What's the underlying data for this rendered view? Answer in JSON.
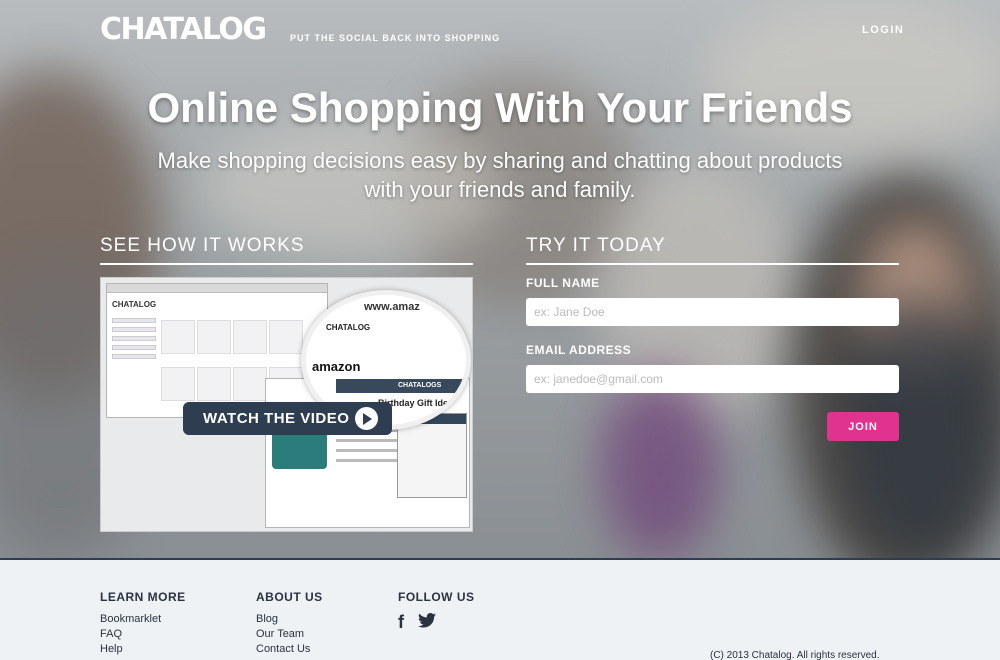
{
  "header": {
    "logo": "CHATALOG",
    "tagline": "PUT THE SOCIAL BACK INTO SHOPPING",
    "login_label": "LOGIN"
  },
  "hero": {
    "headline": "Online Shopping With Your Friends",
    "subheadline": "Make shopping decisions easy by sharing and chatting about products with your friends and family."
  },
  "video_section": {
    "title": "SEE HOW IT WORKS",
    "button_label": "WATCH THE VIDEO",
    "thumbnail": {
      "app_logo": "CHATALOG",
      "url_text": "www.amaz",
      "tab_text": "CHATALOG",
      "site_text": "amazon",
      "nav_text": "CHATALOGS",
      "list_title": "Birthday Gift Ideas"
    }
  },
  "signup": {
    "title": "TRY IT TODAY",
    "full_name_label": "FULL NAME",
    "full_name_placeholder": "ex: Jane Doe",
    "email_label": "EMAIL ADDRESS",
    "email_placeholder": "ex: janedoe@gmail.com",
    "join_label": "JOIN"
  },
  "footer": {
    "learn_more": {
      "title": "LEARN MORE",
      "links": [
        "Bookmarklet",
        "FAQ",
        "Help"
      ]
    },
    "about_us": {
      "title": "ABOUT US",
      "links": [
        "Blog",
        "Our Team",
        "Contact Us"
      ]
    },
    "follow_us": {
      "title": "FOLLOW US",
      "icons": [
        "facebook-icon",
        "twitter-icon"
      ]
    },
    "copyright": "(C) 2013 Chatalog. All rights reserved."
  },
  "colors": {
    "accent_pink": "#e0338f",
    "navy": "#2f3d50",
    "footer_bg": "#eef2f5"
  }
}
